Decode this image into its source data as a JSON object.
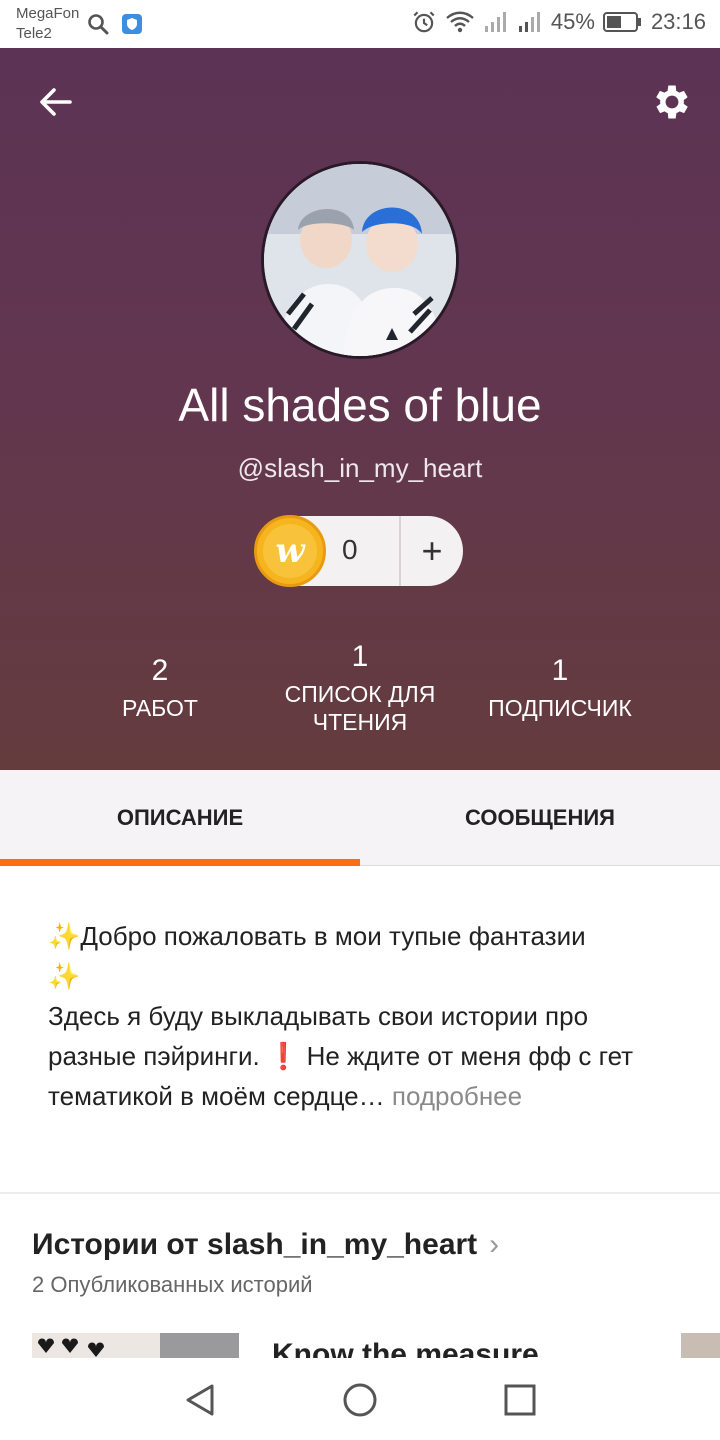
{
  "status_bar": {
    "carrier1": "MegaFon",
    "carrier2": "Tele2",
    "battery": "45%",
    "time": "23:16"
  },
  "profile": {
    "name": "All shades of blue",
    "handle": "@slash_in_my_heart",
    "coins": "0",
    "coin_symbol": "w",
    "plus": "+"
  },
  "stats": [
    {
      "num": "2",
      "label": "РАБОТ"
    },
    {
      "num": "1",
      "label": "СПИСОК ДЛЯ ЧТЕНИЯ"
    },
    {
      "num": "1",
      "label": "ПОДПИСЧИК"
    }
  ],
  "tabs": {
    "description": "ОПИСАНИЕ",
    "messages": "СООБЩЕНИЯ"
  },
  "description": {
    "sparkle": "✨",
    "line1": "Добро пожаловать в мои тупые фантазии",
    "line2_a": "Здесь я буду выкладывать свои истории про разные пэйринги. ",
    "exclaim": "❗",
    "line2_b": "Не ждите от меня фф с гет тематикой в моём сердце",
    "ellipsis": "… ",
    "more": "подробнее"
  },
  "stories": {
    "title": "Истории от slash_in_my_heart",
    "chevron": "›",
    "subtitle": "2 Опубликованных историй",
    "first_story_title": "Know the measure"
  },
  "colors": {
    "accent": "#ff6a15",
    "header_top": "#5c3355",
    "header_bottom": "#643c3e",
    "coin": "#f6b51f"
  },
  "icons": {
    "back": "arrow-left-icon",
    "settings": "gear-icon",
    "nav_back": "triangle-back-icon",
    "nav_home": "circle-home-icon",
    "nav_recent": "square-recent-icon"
  }
}
